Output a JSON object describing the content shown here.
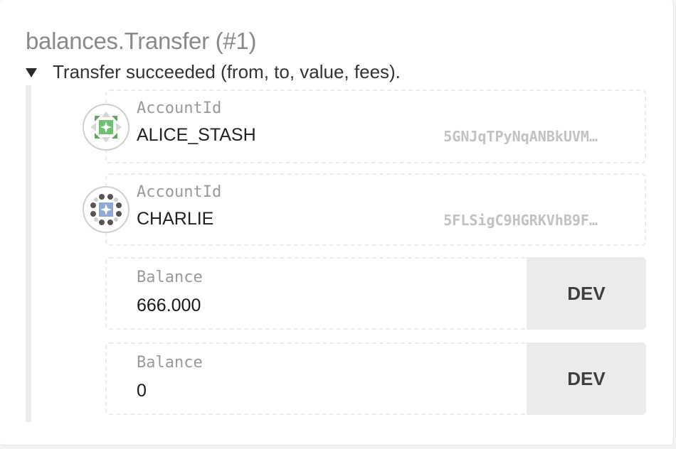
{
  "event": {
    "title": "balances.Transfer (#1)",
    "summary": "Transfer succeeded (from, to, value, fees)."
  },
  "params": [
    {
      "type_label": "AccountId",
      "name": "ALICE_STASH",
      "address": "5GNJqTPyNqANBkUVM…",
      "identicon": "polkadot-identicon"
    },
    {
      "type_label": "AccountId",
      "name": "CHARLIE",
      "address": "5FLSigC9HGRKVhB9F…",
      "identicon": "polkadot-identicon"
    },
    {
      "type_label": "Balance",
      "value": "666.000",
      "unit": "DEV"
    },
    {
      "type_label": "Balance",
      "value": "0",
      "unit": "DEV"
    }
  ],
  "colors": {
    "identicon_alice": "#6cc36f",
    "identicon_charlie": "#8fa9d8",
    "identicon_dots": "#555555"
  }
}
